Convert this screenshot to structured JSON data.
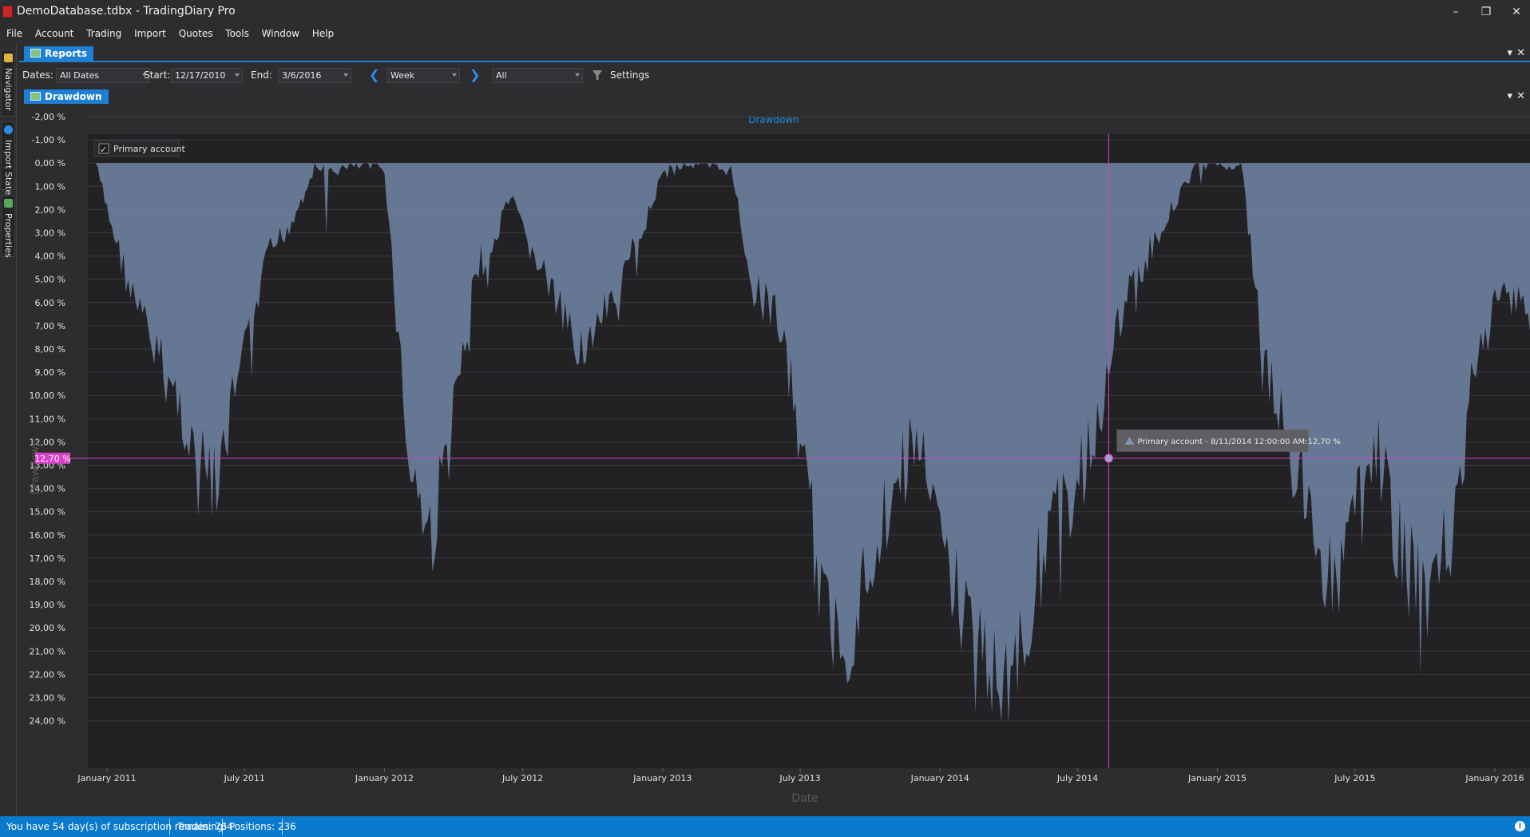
{
  "window": {
    "title": "DemoDatabase.tdbx - TradingDiary Pro",
    "minimize_glyph": "–",
    "restore_glyph": "❐",
    "close_glyph": "✕"
  },
  "menu": [
    "File",
    "Account",
    "Trading",
    "Import",
    "Quotes",
    "Tools",
    "Window",
    "Help"
  ],
  "sidebar": {
    "tabs": [
      "Navigator",
      "Import State",
      "Properties"
    ]
  },
  "reports_tab": {
    "label": "Reports"
  },
  "toolbar": {
    "dates_label": "Dates:",
    "dates_value": "All Dates",
    "start_label": "Start:",
    "start_value": "12/17/2010",
    "end_label": "End:",
    "end_value": "3/6/2016",
    "period_value": "Week",
    "filter_value": "All",
    "settings_label": "Settings"
  },
  "drawdown_tab": {
    "label": "Drawdown"
  },
  "colors": {
    "accent": "#1f7fd4",
    "area": "#6b7f9c",
    "crosshair": "#d940c8",
    "status": "#0a7acc"
  },
  "chart_data": {
    "type": "area",
    "title": "Drawdown",
    "xlabel": "Date",
    "ylabel": "Drawdown",
    "y_inverted": true,
    "ylim": [
      -2.5,
      25
    ],
    "yticks": [
      "-2,00 %",
      "-1,00 %",
      "0,00 %",
      "1,00 %",
      "2,00 %",
      "3,00 %",
      "4,00 %",
      "5,00 %",
      "6,00 %",
      "7,00 %",
      "8,00 %",
      "9,00 %",
      "10,00 %",
      "11,00 %",
      "12,00 %",
      "13,00 %",
      "14,00 %",
      "15,00 %",
      "16,00 %",
      "17,00 %",
      "18,00 %",
      "19,00 %",
      "20,00 %",
      "21,00 %",
      "22,00 %",
      "23,00 %",
      "24,00 %"
    ],
    "xticks": [
      "January 2011",
      "July 2011",
      "January 2012",
      "July 2012",
      "January 2013",
      "July 2013",
      "January 2014",
      "July 2014",
      "January 2015",
      "July 2015",
      "January 2016"
    ],
    "legend": {
      "label": "Primary account",
      "checked": true,
      "position": "top-left"
    },
    "series": [
      {
        "name": "Primary account",
        "x": [
          "2010-12-17",
          "2011-01-01",
          "2011-02-01",
          "2011-03-01",
          "2011-04-01",
          "2011-05-01",
          "2011-05-25",
          "2011-06-15",
          "2011-07-01",
          "2011-08-01",
          "2011-09-01",
          "2011-10-01",
          "2011-11-01",
          "2011-12-01",
          "2012-01-01",
          "2012-02-01",
          "2012-03-01",
          "2012-04-01",
          "2012-05-01",
          "2012-05-25",
          "2012-06-15",
          "2012-07-01",
          "2012-08-01",
          "2012-09-01",
          "2012-10-01",
          "2012-11-01",
          "2012-12-01",
          "2013-01-01",
          "2013-02-01",
          "2013-03-01",
          "2013-04-01",
          "2013-05-01",
          "2013-06-01",
          "2013-07-01",
          "2013-08-01",
          "2013-09-01",
          "2013-10-01",
          "2013-11-01",
          "2013-12-01",
          "2014-01-01",
          "2014-02-01",
          "2014-03-01",
          "2014-04-01",
          "2014-05-01",
          "2014-05-20",
          "2014-06-15",
          "2014-07-15",
          "2014-08-11",
          "2014-09-01",
          "2014-10-01",
          "2014-11-01",
          "2014-12-01",
          "2015-01-01",
          "2015-02-01",
          "2015-03-01",
          "2015-04-01",
          "2015-05-01",
          "2015-06-01",
          "2015-07-01",
          "2015-08-01",
          "2015-09-01",
          "2015-10-01",
          "2015-11-01",
          "2015-12-01",
          "2016-01-01",
          "2016-02-01",
          "2016-03-06"
        ],
        "values": [
          0.0,
          2.0,
          5.5,
          7.8,
          10.0,
          12.5,
          14.2,
          10.5,
          8.5,
          4.0,
          2.5,
          0.2,
          0.3,
          0.1,
          0.2,
          12.5,
          16.3,
          11.0,
          4.5,
          3.5,
          1.5,
          3.0,
          5.0,
          7.5,
          7.8,
          5.5,
          3.0,
          0.5,
          0.0,
          0.2,
          0.3,
          5.5,
          6.5,
          12.0,
          19.5,
          20.5,
          17.0,
          14.0,
          12.0,
          16.0,
          19.5,
          21.0,
          22.5,
          19.0,
          16.5,
          15.0,
          12.7,
          9.0,
          6.0,
          4.0,
          2.0,
          0.0,
          0.1,
          0.0,
          8.0,
          12.0,
          15.0,
          18.0,
          15.5,
          12.5,
          17.0,
          18.8,
          16.5,
          10.0,
          6.0,
          5.5,
          8.0
        ]
      }
    ],
    "crosshair": {
      "y_label": "12,70 %",
      "tooltip": "Primary account - 8/11/2014 12:00:00 AM:12,70 %"
    }
  },
  "status": {
    "subscription": "You have 54 day(s) of subscription remaining!",
    "trades": "Trades: 764",
    "positions": "Positions: 236",
    "info_glyph": "i"
  }
}
